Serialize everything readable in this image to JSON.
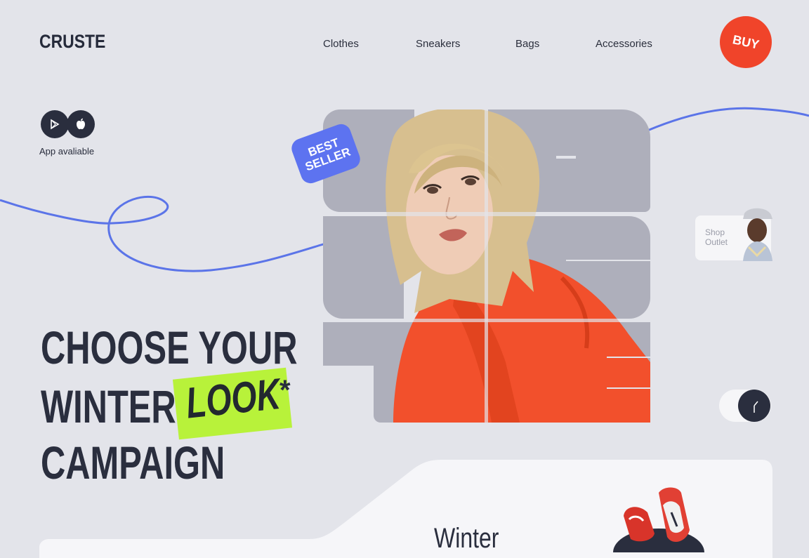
{
  "brand": {
    "logo": "CRUSTE"
  },
  "nav": {
    "items": [
      "Clothes",
      "Sneakers",
      "Bags",
      "Accessories"
    ]
  },
  "buy_button": {
    "label": "BUY"
  },
  "app": {
    "label": "App avaliable",
    "icons": [
      "google-play-icon",
      "apple-icon"
    ]
  },
  "hero": {
    "line1": "CHOOSE YOUR",
    "line2": "WINTER",
    "highlight": "LOOK",
    "asterisk": "*",
    "line3": "CAMPAIGN"
  },
  "badge": {
    "line1": "BEST",
    "line2": "SELLER"
  },
  "shop_outlet": {
    "line1": "Shop",
    "line2": "Outlet"
  },
  "bottom_panel": {
    "title": "Winter"
  },
  "colors": {
    "accent_red": "#f0442a",
    "accent_blue": "#5d73f0",
    "accent_lime": "#b8f23a",
    "dark": "#2a2e3e",
    "background": "#e3e4ea"
  }
}
